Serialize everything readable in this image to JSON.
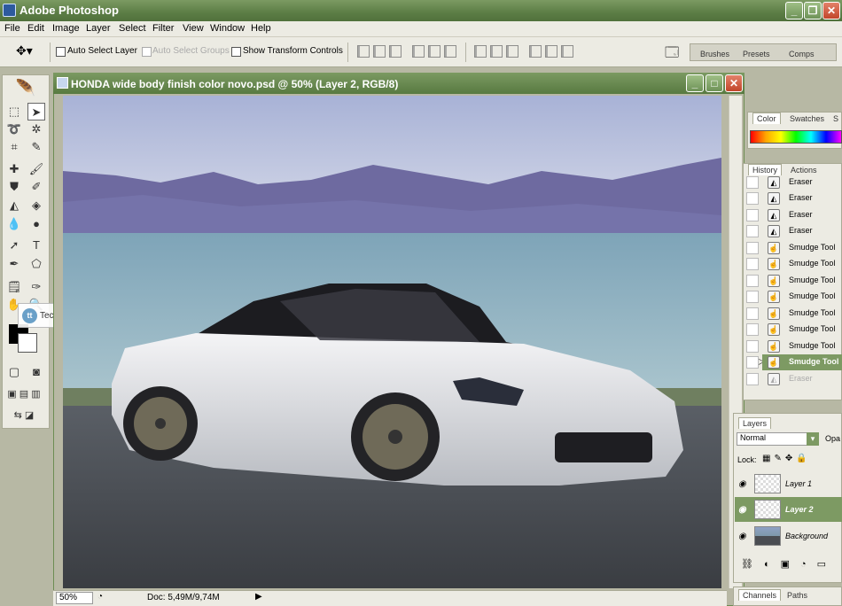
{
  "window": {
    "title": "Adobe Photoshop"
  },
  "menu": [
    "File",
    "Edit",
    "Image",
    "Layer",
    "Select",
    "Filter",
    "View",
    "Window",
    "Help"
  ],
  "options": {
    "auto_select_layer": "Auto Select Layer",
    "auto_select_groups": "Auto Select Groups",
    "show_transform": "Show Transform Controls"
  },
  "well_tabs": [
    "Brushes",
    "Presets",
    "Comps"
  ],
  "watermark": {
    "logo": "tt",
    "text": "TechTut.com"
  },
  "document": {
    "title": "HONDA wide body finish color novo.psd @ 50% (Layer 2, RGB/8)",
    "zoom": "50%",
    "doc_info": "Doc: 5,49M/9,74M"
  },
  "color_panel": {
    "tabs": [
      "Color",
      "Swatches",
      "S"
    ]
  },
  "history_panel": {
    "tabs": [
      "History",
      "Actions"
    ],
    "items": [
      {
        "label": "Eraser",
        "icon": "eraser-icon",
        "state": "normal"
      },
      {
        "label": "Eraser",
        "icon": "eraser-icon",
        "state": "normal"
      },
      {
        "label": "Eraser",
        "icon": "eraser-icon",
        "state": "normal"
      },
      {
        "label": "Eraser",
        "icon": "eraser-icon",
        "state": "normal"
      },
      {
        "label": "Smudge Tool",
        "icon": "smudge-icon",
        "state": "normal"
      },
      {
        "label": "Smudge Tool",
        "icon": "smudge-icon",
        "state": "normal"
      },
      {
        "label": "Smudge Tool",
        "icon": "smudge-icon",
        "state": "normal"
      },
      {
        "label": "Smudge Tool",
        "icon": "smudge-icon",
        "state": "normal"
      },
      {
        "label": "Smudge Tool",
        "icon": "smudge-icon",
        "state": "normal"
      },
      {
        "label": "Smudge Tool",
        "icon": "smudge-icon",
        "state": "normal"
      },
      {
        "label": "Smudge Tool",
        "icon": "smudge-icon",
        "state": "normal"
      },
      {
        "label": "Smudge Tool",
        "icon": "smudge-icon",
        "state": "selected"
      },
      {
        "label": "Eraser",
        "icon": "eraser-icon",
        "state": "dimmed"
      }
    ]
  },
  "layers_panel": {
    "tab": "Layers",
    "blend_mode": "Normal",
    "opacity_label": "Opa",
    "lock_label": "Lock:",
    "layers": [
      {
        "name": "Layer 1",
        "selected": false
      },
      {
        "name": "Layer 2",
        "selected": true
      },
      {
        "name": "Background",
        "selected": false
      }
    ]
  },
  "bottom_tabs": [
    "Channels",
    "Paths"
  ],
  "colors": {
    "accent": "#7d9a63",
    "chrome": "#ecebe3",
    "titlebar": "#5c7d45"
  }
}
